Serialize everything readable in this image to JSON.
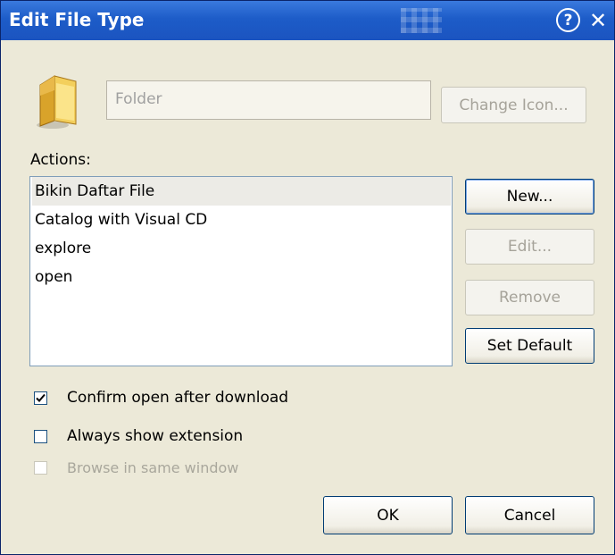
{
  "window": {
    "title": "Edit File Type",
    "help_glyph": "?",
    "close_glyph": "✕"
  },
  "file_type": {
    "name_value": "Folder",
    "change_icon_label": "Change Icon..."
  },
  "actions": {
    "label": "Actions:",
    "items": [
      "Bikin Daftar File",
      "Catalog with Visual CD",
      "explore",
      "open"
    ],
    "selected_index": 0,
    "new_label": "New...",
    "edit_label": "Edit...",
    "remove_label": "Remove",
    "set_default_label": "Set Default"
  },
  "options": {
    "confirm_open_label": "Confirm open after download",
    "confirm_open_checked": true,
    "always_show_ext_label": "Always show extension",
    "always_show_ext_checked": false,
    "browse_same_label": "Browse in same window",
    "browse_same_checked": false
  },
  "footer": {
    "ok_label": "OK",
    "cancel_label": "Cancel"
  },
  "icons": {
    "folder": "folder-icon",
    "help": "help-icon",
    "close": "close-icon",
    "check": "checkmark-icon"
  }
}
